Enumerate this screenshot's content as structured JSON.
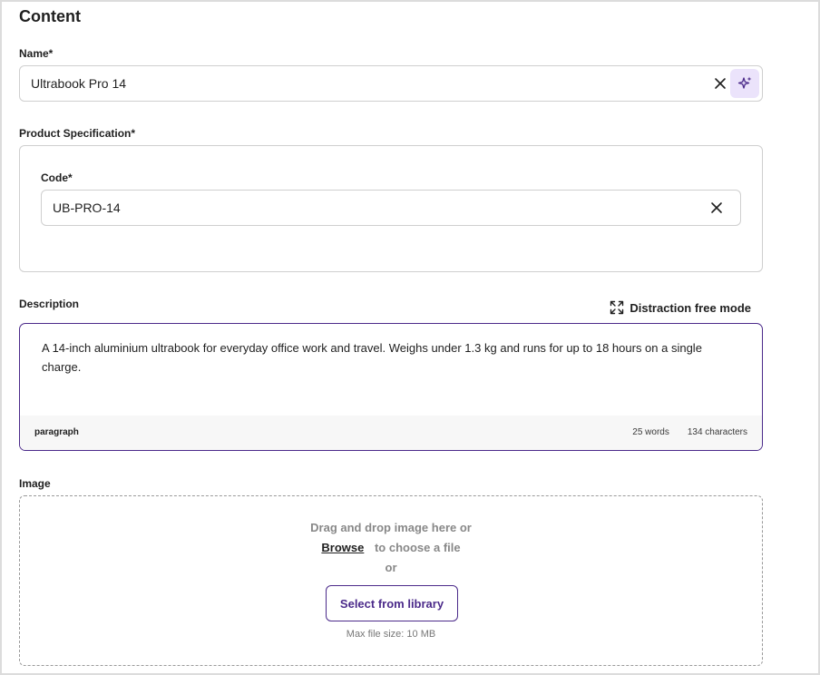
{
  "section": {
    "title": "Content"
  },
  "name_field": {
    "label": "Name*",
    "value": "Ultrabook Pro 14"
  },
  "spec": {
    "label": "Product Specification*",
    "code_label": "Code*",
    "code_value": "UB-PRO-14"
  },
  "description": {
    "label": "Description",
    "distraction_free_label": "Distraction free mode",
    "text": "A 14-inch aluminium ultrabook for everyday office work and travel. Weighs under 1.3 kg and runs for up to 18 hours on a single charge.",
    "block_type": "paragraph",
    "word_count": "25 words",
    "char_count": "134 characters"
  },
  "image": {
    "label": "Image",
    "drop_text": "Drag and drop image here or",
    "browse_label": "Browse",
    "choose_text": "to choose a file",
    "or_text": "or",
    "library_button": "Select from library",
    "max_size": "Max file size: 10 MB"
  },
  "colors": {
    "accent": "#4b2a8a",
    "ai_bg": "#ebe3fb",
    "border": "#cfcfcf"
  },
  "icons": {
    "clear": "close-icon",
    "ai": "sparkle-icon",
    "expand": "expand-icon"
  }
}
